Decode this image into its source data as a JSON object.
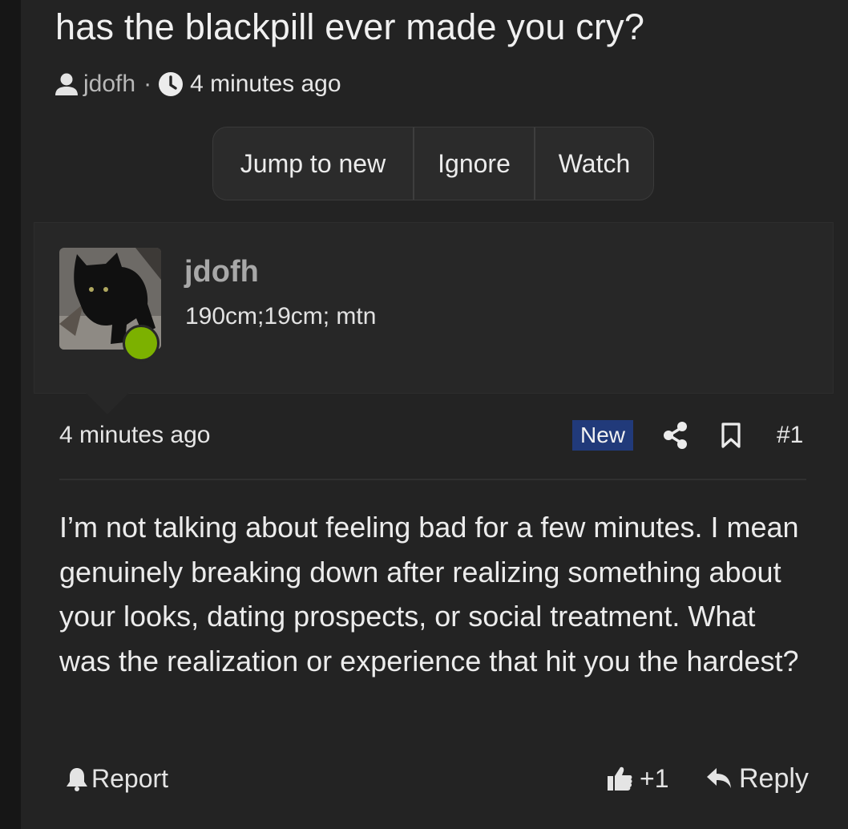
{
  "thread": {
    "title": "has the blackpill ever made you cry?",
    "author": "jdofh",
    "separator": "·",
    "posted": "4 minutes ago"
  },
  "actions": {
    "jump_to_new": "Jump to new",
    "ignore": "Ignore",
    "watch": "Watch"
  },
  "user": {
    "name": "jdofh",
    "title": "190cm;19cm; mtn",
    "online": true
  },
  "post": {
    "time": "4 minutes ago",
    "badge": "New",
    "number": "#1",
    "body": "I’m not talking about feeling bad for a few minutes. I mean genuinely breaking down after realizing something about your looks, dating prospects, or social treatment. What was the realization or experience that hit you the hardest?"
  },
  "footer": {
    "report": "Report",
    "like_count": "+1",
    "reply": "Reply"
  },
  "colors": {
    "background": "#232323",
    "online": "#7cb100",
    "new_badge": "#213a7a"
  }
}
